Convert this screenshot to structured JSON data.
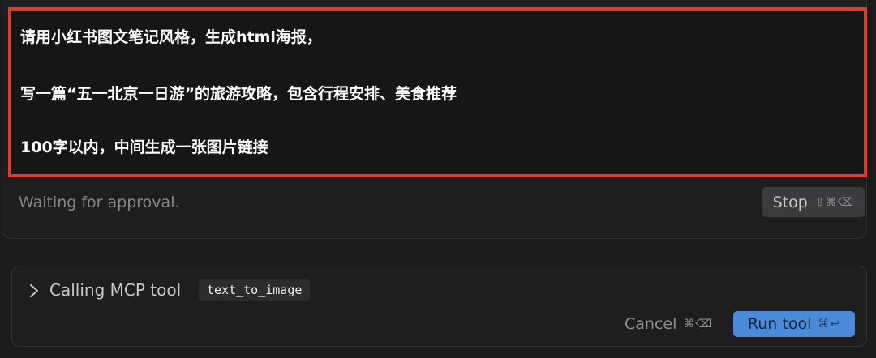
{
  "prompt": {
    "lines": [
      "请用小红书图文笔记风格，生成html海报，",
      "写一篇“五一北京一日游”的旅游攻略，包含行程安排、美食推荐",
      "100字以内，中间生成一张图片链接"
    ]
  },
  "status": {
    "text": "Waiting for approval."
  },
  "stop_button": {
    "label": "Stop",
    "shortcut": "⇧⌘⌫"
  },
  "tool_call": {
    "title": "Calling MCP tool",
    "tool_name": "text_to_image",
    "cancel_label": "Cancel",
    "cancel_shortcut": "⌘⌫",
    "run_label": "Run tool",
    "run_shortcut": "⌘↩"
  },
  "colors": {
    "highlight_border": "#e23a2e",
    "run_button": "#4a8bd8",
    "background": "#1b1b1c"
  }
}
